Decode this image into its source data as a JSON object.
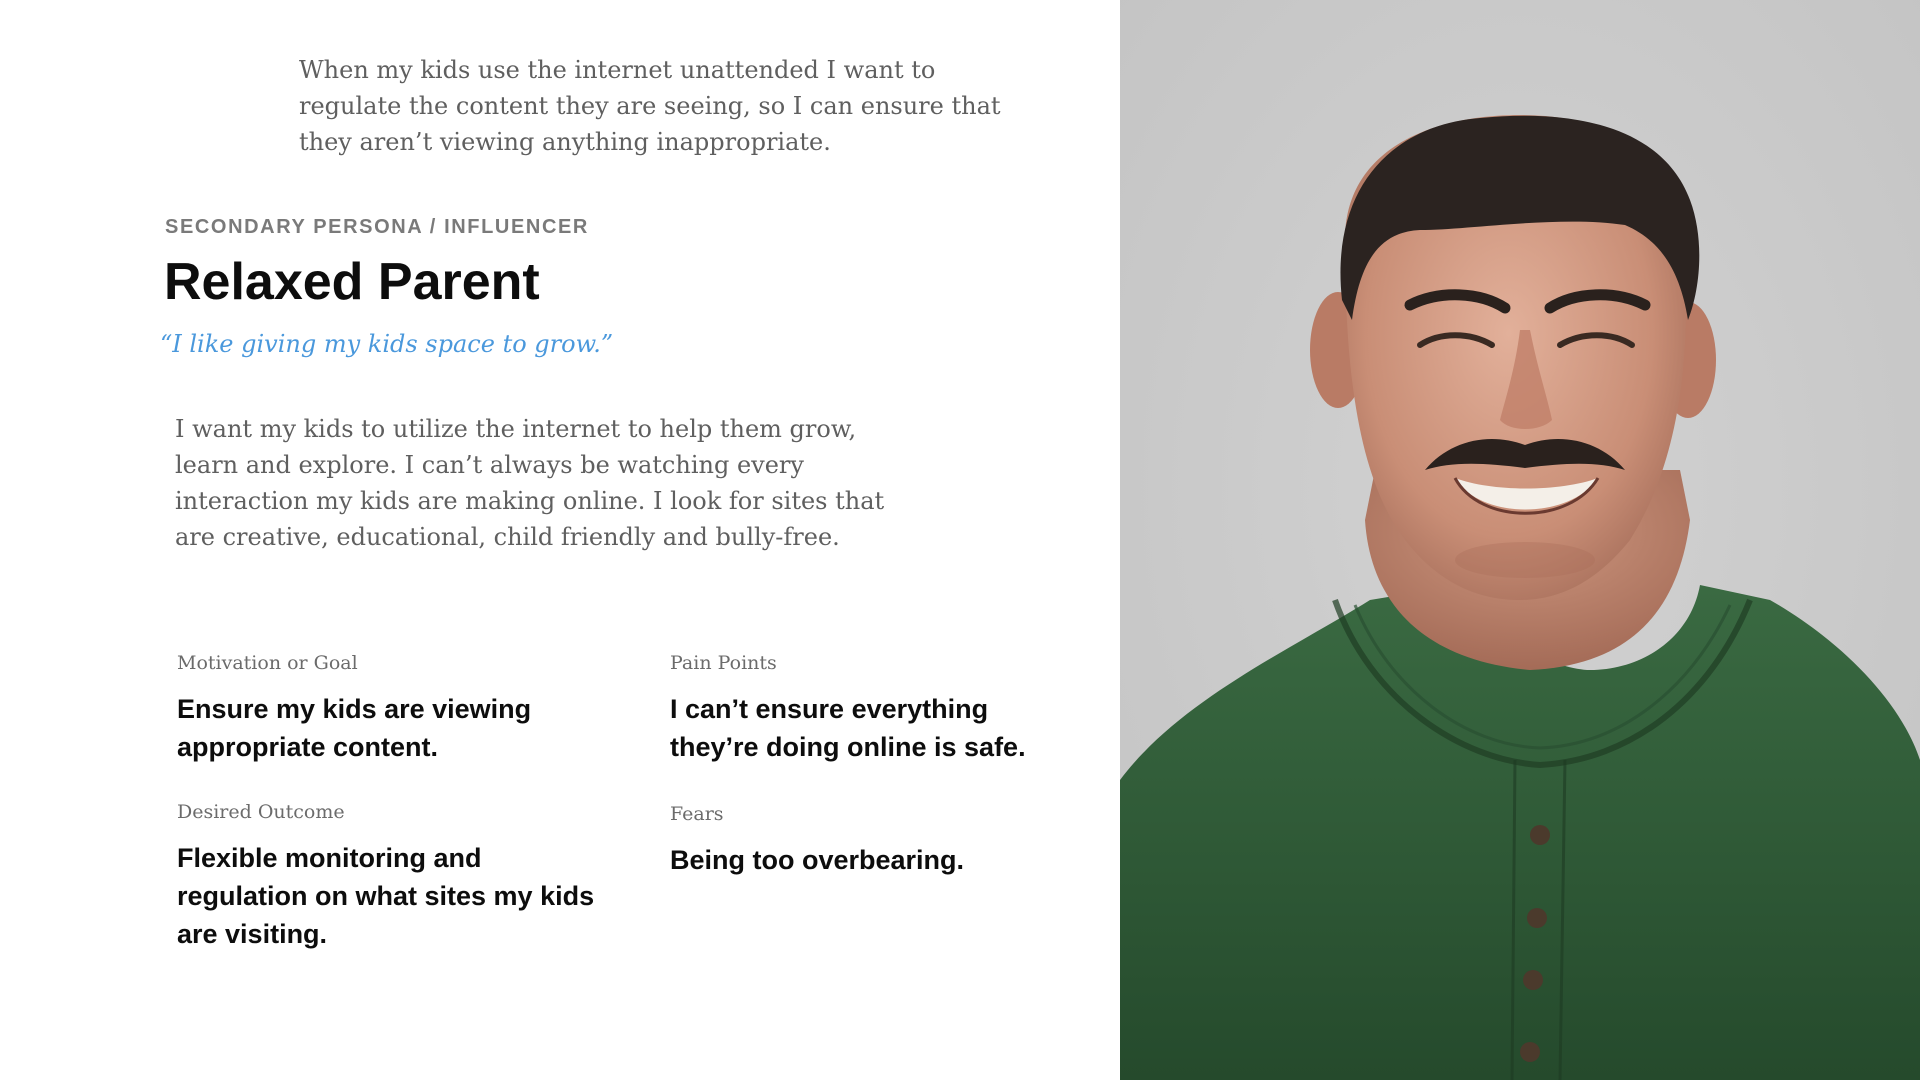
{
  "intro_text": "When my kids use the internet unattended I want to regulate the content they are seeing, so I can ensure that they aren’t viewing anything inappropriate.",
  "persona": {
    "kicker": "SECONDARY PERSONA / INFLUENCER",
    "name": "Relaxed Parent",
    "quote": "“I like giving my kids space to grow.”",
    "bio": "I want my kids to utilize the internet to help them grow, learn and explore. I can’t always be watching every interaction my kids are making online. I look for sites that are creative, educational, child friendly and bully-free."
  },
  "details": {
    "motivation": {
      "label": "Motivation or Goal",
      "value": "Ensure my kids are viewing appropriate content."
    },
    "pain_points": {
      "label": "Pain Points",
      "value": "I can’t ensure everything they’re doing online is safe."
    },
    "desired_outcome": {
      "label": "Desired Outcome",
      "value": "Flexible monitoring and regulation on what sites my kids are visiting."
    },
    "fears": {
      "label": "Fears",
      "value": "Being too overbearing."
    }
  },
  "colors": {
    "quote": "#4a98dc",
    "photo_background": "#c9c9c9",
    "shirt": "#2f5a36"
  }
}
